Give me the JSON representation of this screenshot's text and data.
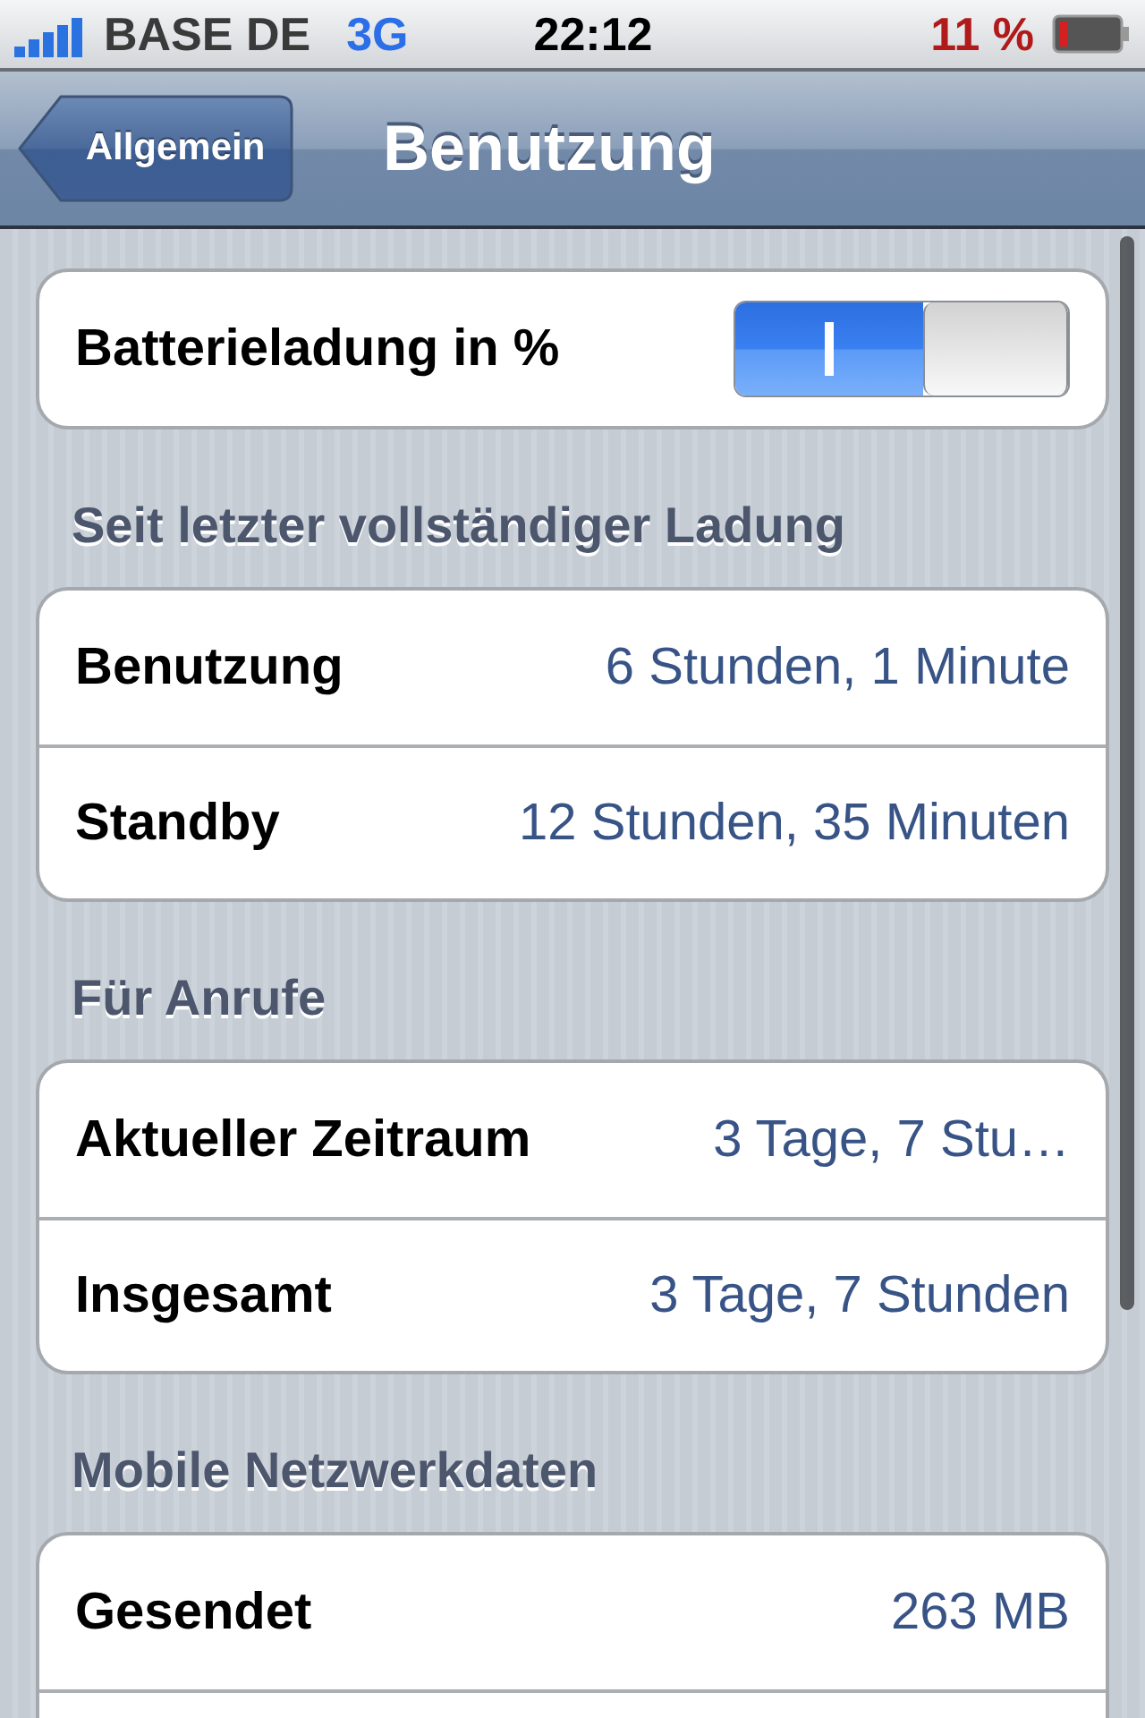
{
  "status_bar": {
    "carrier": "BASE DE",
    "network": "3G",
    "time": "22:12",
    "battery": "11 %"
  },
  "nav_bar": {
    "back_button": "Allgemein",
    "title": "Benutzung"
  },
  "sections": [
    {
      "rows": [
        {
          "kind": "toggle",
          "label": "Batterieladung in %",
          "on": true
        }
      ]
    },
    {
      "header": "Seit letzter vollständiger Ladung",
      "rows": [
        {
          "kind": "value",
          "label": "Benutzung",
          "value": "6 Stunden, 1 Minute"
        },
        {
          "kind": "value",
          "label": "Standby",
          "value": "12 Stunden, 35 Minuten"
        }
      ]
    },
    {
      "header": "Für Anrufe",
      "rows": [
        {
          "kind": "value",
          "label": "Aktueller Zeitraum",
          "value": "3 Tage, 7 Stu…"
        },
        {
          "kind": "value",
          "label": "Insgesamt",
          "value": "3 Tage, 7 Stunden"
        }
      ]
    },
    {
      "header": "Mobile Netzwerkdaten",
      "rows": [
        {
          "kind": "value",
          "label": "Gesendet",
          "value": "263 MB"
        },
        {
          "kind": "empty"
        }
      ]
    }
  ]
}
